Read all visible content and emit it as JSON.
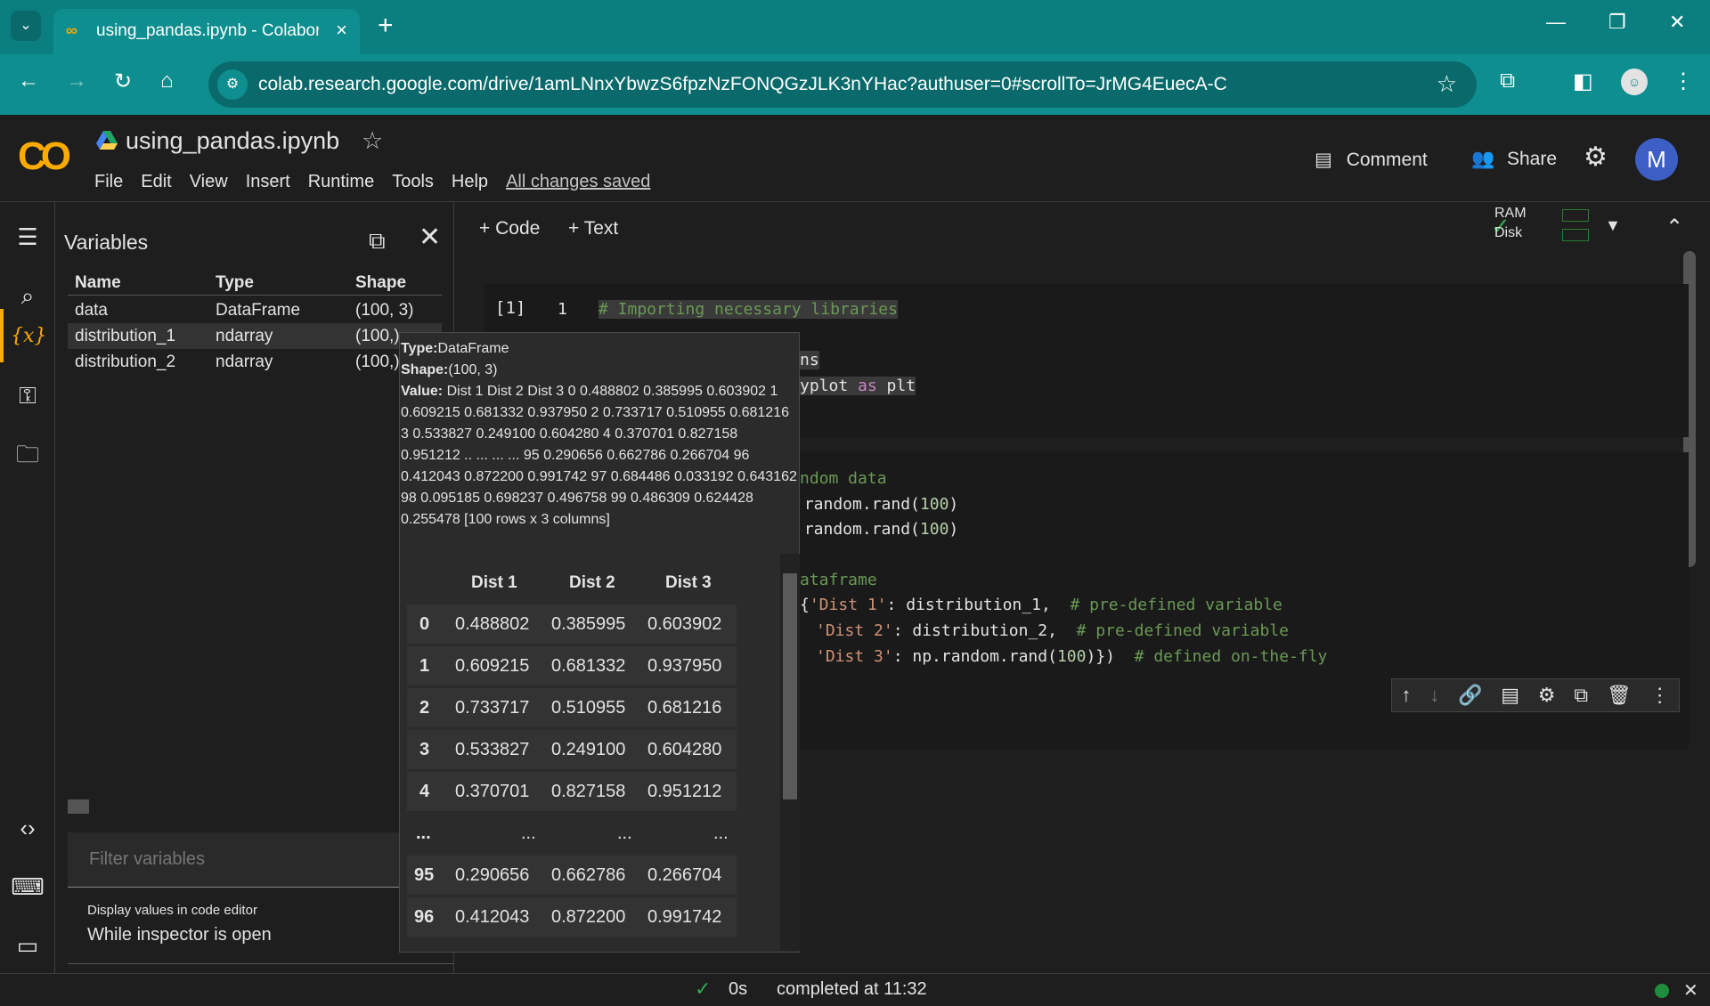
{
  "browser": {
    "tab_title": "using_pandas.ipynb - Colaboratory",
    "url": "colab.research.google.com/drive/1amLNnxYbwzS6fpzNzFONQGzJLK3nYHac?authuser=0#scrollTo=JrMG4EuecA-C"
  },
  "colab": {
    "logo": "CO",
    "file_name": "using_pandas.ipynb",
    "menu": [
      "File",
      "Edit",
      "View",
      "Insert",
      "Runtime",
      "Tools",
      "Help"
    ],
    "save_status": "All changes saved",
    "comment_label": "Comment",
    "share_label": "Share",
    "avatar_letter": "M"
  },
  "toolbar": {
    "code_label": "+ Code",
    "text_label": "+ Text",
    "ram_label": "RAM",
    "disk_label": "Disk"
  },
  "variables": {
    "title": "Variables",
    "headers": [
      "Name",
      "Type",
      "Shape"
    ],
    "rows": [
      {
        "name": "data",
        "type": "DataFrame",
        "shape": "(100, 3)"
      },
      {
        "name": "distribution_1",
        "type": "ndarray",
        "shape": "(100,)"
      },
      {
        "name": "distribution_2",
        "type": "ndarray",
        "shape": "(100,)"
      }
    ],
    "filter_placeholder": "Filter variables",
    "display_label": "Display values in code editor",
    "display_value": "While inspector is open"
  },
  "tooltip": {
    "type_label": "Type:",
    "type_value": "DataFrame",
    "shape_label": "Shape:",
    "shape_value": "(100, 3)",
    "value_label": "Value:",
    "value_text": " Dist 1 Dist 2 Dist 3 0 0.488802 0.385995 0.603902 1 0.609215 0.681332 0.937950 2 0.733717 0.510955 0.681216 3 0.533827 0.249100 0.604280 4 0.370701 0.827158 0.951212 .. ... ... ... 95 0.290656 0.662786 0.266704 96 0.412043 0.872200 0.991742 97 0.684486 0.033192 0.643162 98 0.095185 0.698237 0.496758 99 0.486309 0.624428 0.255478 [100 rows x 3 columns]",
    "columns": [
      "Dist 1",
      "Dist 2",
      "Dist 3"
    ],
    "rows": [
      [
        "0",
        "0.488802",
        "0.385995",
        "0.603902"
      ],
      [
        "1",
        "0.609215",
        "0.681332",
        "0.937950"
      ],
      [
        "2",
        "0.733717",
        "0.510955",
        "0.681216"
      ],
      [
        "3",
        "0.533827",
        "0.249100",
        "0.604280"
      ],
      [
        "4",
        "0.370701",
        "0.827158",
        "0.951212"
      ],
      [
        "...",
        "...",
        "...",
        "..."
      ],
      [
        "95",
        "0.290656",
        "0.662786",
        "0.266704"
      ],
      [
        "96",
        "0.412043",
        "0.872200",
        "0.991742"
      ]
    ]
  },
  "cell1": {
    "exec_count": "[1]",
    "line1_num": "1",
    "line1": "# Importing necessary libraries",
    "line3_tail": "ns",
    "line4_a": "yplot ",
    "line4_kw": "as",
    "line4_b": " plt"
  },
  "cell2": {
    "l1": "ndom data",
    "l2_a": " random.rand(",
    "l2_num": "100",
    "l2_b": ")",
    "l3_a": " random.rand(",
    "l3_num": "100",
    "l3_b": ")",
    "l5": "ataframe",
    "l6_a": "{",
    "l6_str": "'Dist 1'",
    "l6_b": ": distribution_1,  ",
    "l6_cmt": "# pre-defined variable",
    "l7_str": "'Dist 2'",
    "l7_b": ": distribution_2,  ",
    "l7_cmt": "# pre-defined variable",
    "l8_str": "'Dist 3'",
    "l8_b": ": np.random.rand(",
    "l8_num": "100",
    "l8_c": ")})  ",
    "l8_cmt": "# defined on-the-fly"
  },
  "status": {
    "duration": "0s",
    "completed": "completed at 11:32"
  }
}
